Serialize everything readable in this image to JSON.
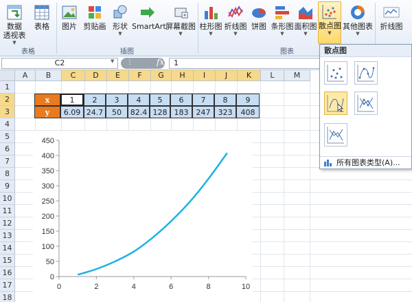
{
  "ribbon": {
    "buttons": [
      {
        "id": "pivot",
        "label1": "数据",
        "label2": "透视表",
        "icon": "pivot-table-icon"
      },
      {
        "id": "table",
        "label1": "表格",
        "icon": "table-icon"
      },
      {
        "id": "picture",
        "label1": "图片",
        "icon": "picture-icon"
      },
      {
        "id": "clipart",
        "label1": "剪贴画",
        "icon": "clipart-icon"
      },
      {
        "id": "shapes",
        "label1": "形状",
        "icon": "shapes-icon"
      },
      {
        "id": "smartart",
        "label1": "SmartArt",
        "icon": "smartart-icon"
      },
      {
        "id": "screenshot",
        "label1": "屏幕截图",
        "icon": "screenshot-icon"
      },
      {
        "id": "column",
        "label1": "柱形图",
        "icon": "column-chart-icon"
      },
      {
        "id": "line",
        "label1": "折线图",
        "icon": "line-chart-icon"
      },
      {
        "id": "pie",
        "label1": "饼图",
        "icon": "pie-chart-icon"
      },
      {
        "id": "bar",
        "label1": "条形图",
        "icon": "bar-chart-icon"
      },
      {
        "id": "area",
        "label1": "面积图",
        "icon": "area-chart-icon"
      },
      {
        "id": "scatter",
        "label1": "散点图",
        "icon": "scatter-chart-icon"
      },
      {
        "id": "other",
        "label1": "其他图表",
        "icon": "other-charts-icon"
      },
      {
        "id": "sparkline",
        "label1": "折线图",
        "icon": "sparkline-icon"
      }
    ],
    "groups": {
      "tables": "表格",
      "illustrations": "插图",
      "charts": "图表"
    }
  },
  "formula_bar": {
    "name_box": "C2",
    "fx": "fx",
    "value": "1"
  },
  "columns": [
    "A",
    "B",
    "C",
    "D",
    "E",
    "F",
    "G",
    "H",
    "I",
    "J",
    "K",
    "L",
    "M"
  ],
  "rows": [
    "1",
    "2",
    "3",
    "4",
    "5",
    "6",
    "7",
    "8",
    "9",
    "10",
    "11",
    "12",
    "13",
    "14",
    "15",
    "16",
    "17",
    "18"
  ],
  "table": {
    "x_label": "x",
    "y_label": "y",
    "x_values": [
      "1",
      "2",
      "3",
      "4",
      "5",
      "6",
      "7",
      "8",
      "9"
    ],
    "y_values": [
      "6.09",
      "24.7",
      "50",
      "82.4",
      "128",
      "183",
      "247",
      "323",
      "408"
    ]
  },
  "gallery": {
    "title": "散点图",
    "footer": "所有图表类型(A)...",
    "items": [
      "scatter-markers-only-icon",
      "scatter-smooth-lines-markers-icon",
      "scatter-smooth-lines-icon",
      "scatter-straight-lines-markers-icon",
      "scatter-straight-lines-icon"
    ]
  },
  "chart_data": {
    "type": "scatter",
    "x": [
      1,
      2,
      3,
      4,
      5,
      6,
      7,
      8,
      9
    ],
    "y": [
      6.09,
      24.7,
      50,
      82.4,
      128,
      183,
      247,
      323,
      408
    ],
    "xlim": [
      0,
      10
    ],
    "ylim": [
      0,
      450
    ],
    "x_ticks": [
      "0",
      "2",
      "4",
      "6",
      "8",
      "10"
    ],
    "y_ticks": [
      "0",
      "50",
      "100",
      "150",
      "200",
      "250",
      "300",
      "350",
      "400",
      "450"
    ],
    "title": "",
    "xlabel": "",
    "ylabel": "",
    "line_color": "#1ab0e8",
    "style": "smooth-line"
  }
}
